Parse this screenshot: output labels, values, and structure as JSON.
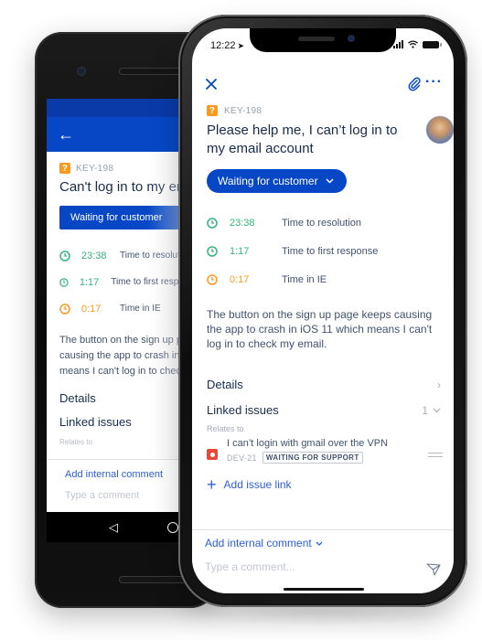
{
  "android": {
    "back_icon": "arrow-left-icon",
    "issue_key": "KEY-198",
    "issue_type_icon": "question-icon",
    "issue_type_glyph": "?",
    "title": "Can't log in to my email account",
    "status_button": "Waiting for customer",
    "sla": [
      {
        "time": "23:38",
        "label": "Time to resolution",
        "color": "#36b37e"
      },
      {
        "time": "1:17",
        "label": "Time to first response",
        "color": "#36b37e"
      },
      {
        "time": "0:17",
        "label": "Time in IE",
        "color": "#ff991f"
      }
    ],
    "description": [
      "The button on the sign up page keeps",
      "causing the app to crash in iOS 11 which",
      "means I can't log in to check my email."
    ],
    "details_label": "Details",
    "linked_issues_label": "Linked issues",
    "relates_to": "Relates to",
    "add_comment": "Add internal comment",
    "comment_placeholder": "Type a comment",
    "nav_back_glyph": "◁"
  },
  "iphone": {
    "status_bar": {
      "time": "12:22",
      "location_glyph": "➤",
      "wifi_glyph": "≋"
    },
    "topbar": {
      "close_icon": "close-icon",
      "attach_icon": "paperclip-icon",
      "more_glyph": "···"
    },
    "issue_key": "KEY-198",
    "issue_type_glyph": "?",
    "title": "Please help me, I can’t log in to my email account",
    "status_button": "Waiting for customer",
    "status_chevron": "⌄",
    "sla": [
      {
        "time": "23:38",
        "label": "Time to resolution",
        "color": "#36b37e"
      },
      {
        "time": "1:17",
        "label": "Time to first response",
        "color": "#36b37e"
      },
      {
        "time": "0:17",
        "label": "Time in IE",
        "color": "#ff991f"
      }
    ],
    "description": "The button on the sign up page keeps causing the app to crash in iOS 11 which means I can't log in to check my email.",
    "details_label": "Details",
    "details_chevron": "›",
    "linked_issues_label": "Linked issues",
    "linked_issues_count": "1",
    "linked_issues_chevron": "⌄",
    "relates_to": "Relates to",
    "linked_issue": {
      "title": "I can’t login with gmail over the VPN",
      "key": "DEV-21",
      "status": "WAITING FOR SUPPORT"
    },
    "add_issue_link": "Add issue link",
    "add_issue_link_glyph": "+",
    "add_comment": "Add internal comment",
    "add_comment_chevron": "⌄",
    "comment_placeholder": "Type a comment..."
  },
  "colors": {
    "brand_blue": "#0747c6",
    "link_blue": "#2b5fd9",
    "text_dark": "#172b4d",
    "text_muted": "#42526e",
    "sla_green": "#36b37e",
    "sla_orange": "#ff991f",
    "bug_red": "#e5493a",
    "question_orange": "#f79a1e"
  }
}
